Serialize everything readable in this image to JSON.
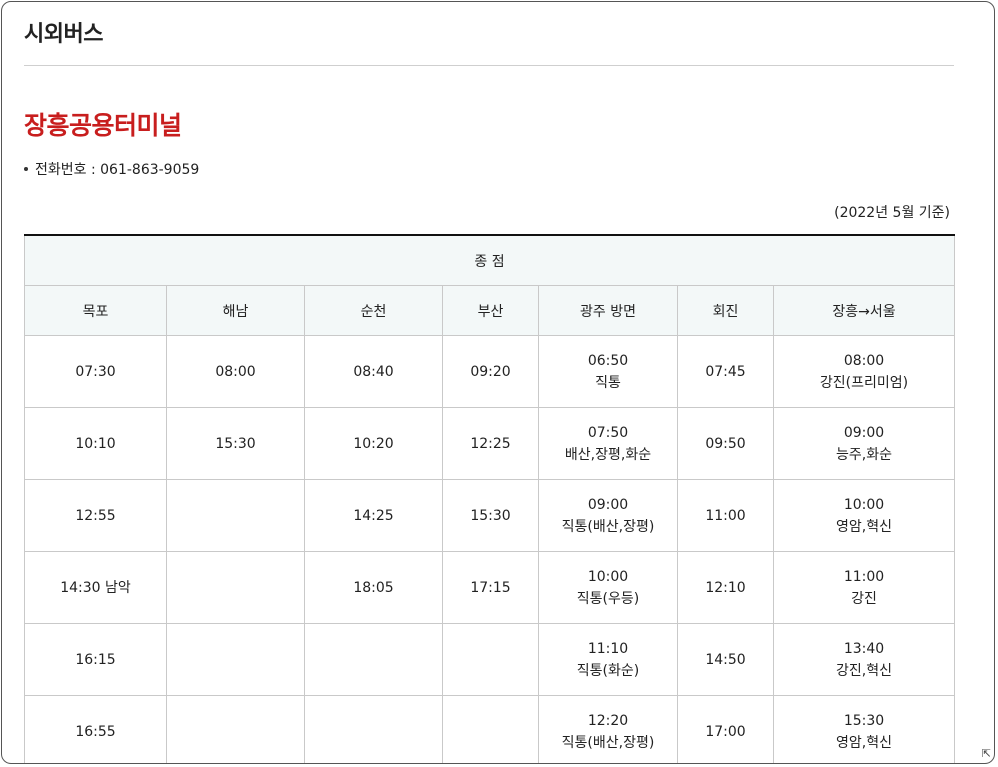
{
  "page": {
    "title": "시외버스"
  },
  "terminal": {
    "name": "장흥공용터미널",
    "phone_label": "전화번호 : 061-863-9059",
    "basis": "(2022년 5월 기준)"
  },
  "table": {
    "group_header": "종 점",
    "columns": [
      "목포",
      "해남",
      "순천",
      "부산",
      "광주 방면",
      "회진",
      "장흥→서울"
    ],
    "rows": [
      [
        [
          "07:30"
        ],
        [
          "08:00"
        ],
        [
          "08:40"
        ],
        [
          "09:20"
        ],
        [
          "06:50",
          "직통"
        ],
        [
          "07:45"
        ],
        [
          "08:00",
          "강진(프리미엄)"
        ]
      ],
      [
        [
          "10:10"
        ],
        [
          "15:30"
        ],
        [
          "10:20"
        ],
        [
          "12:25"
        ],
        [
          "07:50",
          "배산,장평,화순"
        ],
        [
          "09:50"
        ],
        [
          "09:00",
          "능주,화순"
        ]
      ],
      [
        [
          "12:55"
        ],
        [],
        [
          "14:25"
        ],
        [
          "15:30"
        ],
        [
          "09:00",
          "직통(배산,장평)"
        ],
        [
          "11:00"
        ],
        [
          "10:00",
          "영암,혁신"
        ]
      ],
      [
        [
          "14:30 남악"
        ],
        [],
        [
          "18:05"
        ],
        [
          "17:15"
        ],
        [
          "10:00",
          "직통(우등)"
        ],
        [
          "12:10"
        ],
        [
          "11:00",
          "강진"
        ]
      ],
      [
        [
          "16:15"
        ],
        [],
        [],
        [],
        [
          "11:10",
          "직통(화순)"
        ],
        [
          "14:50"
        ],
        [
          "13:40",
          "강진,혁신"
        ]
      ],
      [
        [
          "16:55"
        ],
        [],
        [],
        [],
        [
          "12:20",
          "직통(배산,장평)"
        ],
        [
          "17:00"
        ],
        [
          "15:30",
          "영암,혁신"
        ]
      ]
    ]
  },
  "icons": {
    "resize": "resize-corner-icon"
  }
}
